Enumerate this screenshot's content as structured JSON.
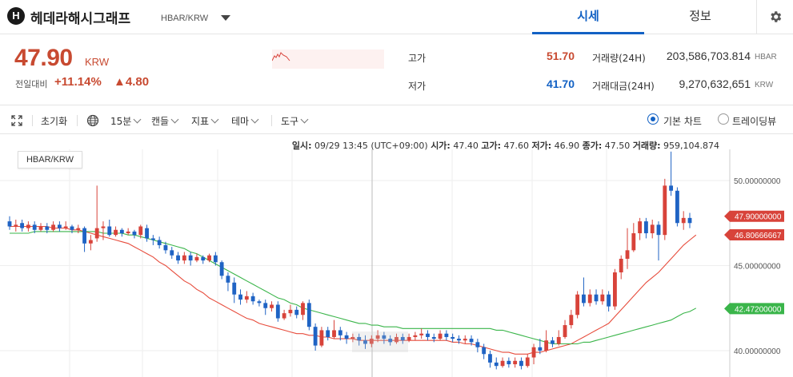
{
  "header": {
    "logo_letter": "H",
    "coin_name": "헤데라해시그래프",
    "pair": "HBAR/KRW",
    "tabs": [
      "시세",
      "정보"
    ],
    "active_tab": 0
  },
  "summary": {
    "price": "47.90",
    "currency": "KRW",
    "change_label": "전일대비",
    "change_rate": "+11.14%",
    "change_amount": "▲4.80",
    "high_label": "고가",
    "high_value": "51.70",
    "low_label": "저가",
    "low_value": "41.70",
    "volume_label": "거래량(24H)",
    "volume_value": "203,586,703.814",
    "volume_unit": "HBAR",
    "turnover_label": "거래대금(24H)",
    "turnover_value": "9,270,632,651",
    "turnover_unit": "KRW"
  },
  "toolbar": {
    "reset": "초기화",
    "interval": "15분",
    "candle": "캔들",
    "indicator": "지표",
    "theme": "테마",
    "tools": "도구",
    "basic_chart": "기본 차트",
    "trading_view": "트레이딩뷰",
    "selected_chart": "basic"
  },
  "chart_info": {
    "time_label": "일시:",
    "time_value": "09/29 13:45 (UTC+09:00)",
    "open_label": "시가:",
    "open_value": "47.40",
    "high_label": "고가:",
    "high_value": "47.60",
    "low_label": "저가:",
    "low_value": "46.90",
    "close_label": "종가:",
    "close_value": "47.50",
    "volume_label": "거래량:",
    "volume_value": "959,104.874",
    "pair_label": "HBAR/KRW"
  },
  "chart_data": {
    "type": "candlestick",
    "ylim": [
      38.5,
      51.0
    ],
    "y_ticks": [
      "50.00000000",
      "45.00000000",
      "40.00000000"
    ],
    "y_tick_values": [
      50,
      45,
      40
    ],
    "price_tags": [
      {
        "label": "47.90000000",
        "value": 47.9,
        "color": "#d8433a"
      },
      {
        "label": "46.80666667",
        "value": 46.80666667,
        "color": "#d8433a"
      },
      {
        "label": "42.47200000",
        "value": 42.472,
        "color": "#3ab54a"
      }
    ],
    "up_color": "#d8433a",
    "down_color": "#1f63c4",
    "candles": [
      [
        47.6,
        47.3,
        47.9,
        47.1
      ],
      [
        47.3,
        47.4,
        47.7,
        47.0
      ],
      [
        47.5,
        47.2,
        47.7,
        47.0
      ],
      [
        47.2,
        47.4,
        47.6,
        47.0
      ],
      [
        47.4,
        47.1,
        47.6,
        46.9
      ],
      [
        47.1,
        47.3,
        47.5,
        47.0
      ],
      [
        47.3,
        47.1,
        47.5,
        46.9
      ],
      [
        47.1,
        47.4,
        47.6,
        47.0
      ],
      [
        47.4,
        47.2,
        47.6,
        47.0
      ],
      [
        47.2,
        47.3,
        47.6,
        47.1
      ],
      [
        47.3,
        47.1,
        47.4,
        46.9
      ],
      [
        47.1,
        47.2,
        47.4,
        46.9
      ],
      [
        47.2,
        46.3,
        47.3,
        45.8
      ],
      [
        46.3,
        46.5,
        46.8,
        45.9
      ],
      [
        46.6,
        47.2,
        49.7,
        46.4
      ],
      [
        47.2,
        47.3,
        47.6,
        46.5
      ],
      [
        47.3,
        46.8,
        47.7,
        46.7
      ],
      [
        46.8,
        47.1,
        47.3,
        46.7
      ],
      [
        47.1,
        46.9,
        47.2,
        46.7
      ],
      [
        46.9,
        47.0,
        47.2,
        46.8
      ],
      [
        47.0,
        46.8,
        47.1,
        46.6
      ],
      [
        46.8,
        47.3,
        47.4,
        46.6
      ],
      [
        47.2,
        46.6,
        47.4,
        46.4
      ],
      [
        46.6,
        46.5,
        46.8,
        46.2
      ],
      [
        46.5,
        46.2,
        46.7,
        46.0
      ],
      [
        46.2,
        45.9,
        46.4,
        45.7
      ],
      [
        45.9,
        45.6,
        46.1,
        45.4
      ],
      [
        45.6,
        45.3,
        45.8,
        45.1
      ],
      [
        45.3,
        45.6,
        45.8,
        45.1
      ],
      [
        45.6,
        45.3,
        45.8,
        45.0
      ],
      [
        45.3,
        45.5,
        45.7,
        45.2
      ],
      [
        45.5,
        45.3,
        45.6,
        45.1
      ],
      [
        45.3,
        45.6,
        45.7,
        45.2
      ],
      [
        45.6,
        45.2,
        45.8,
        45.0
      ],
      [
        45.2,
        44.4,
        45.3,
        44.2
      ],
      [
        44.4,
        44.0,
        44.6,
        43.5
      ],
      [
        44.0,
        43.3,
        44.3,
        42.8
      ],
      [
        43.3,
        43.0,
        43.6,
        42.7
      ],
      [
        43.0,
        43.2,
        43.5,
        42.8
      ],
      [
        43.2,
        42.9,
        43.4,
        42.7
      ],
      [
        42.9,
        42.8,
        43.0,
        42.6
      ],
      [
        42.8,
        42.5,
        43.0,
        42.1
      ],
      [
        42.5,
        42.7,
        42.9,
        42.3
      ],
      [
        42.7,
        41.9,
        42.9,
        41.7
      ],
      [
        41.9,
        42.2,
        42.4,
        41.8
      ],
      [
        42.2,
        42.4,
        42.7,
        42.0
      ],
      [
        42.4,
        42.1,
        42.6,
        41.9
      ],
      [
        42.1,
        42.8,
        42.9,
        41.8
      ],
      [
        42.8,
        41.4,
        43.0,
        41.2
      ],
      [
        41.4,
        40.3,
        41.6,
        40.0
      ],
      [
        40.3,
        41.2,
        41.4,
        40.2
      ],
      [
        41.2,
        40.8,
        41.4,
        40.6
      ],
      [
        40.8,
        41.2,
        41.8,
        40.7
      ],
      [
        41.2,
        40.9,
        41.4,
        40.6
      ],
      [
        40.9,
        40.7,
        41.1,
        40.4
      ],
      [
        40.7,
        40.8,
        41.0,
        40.5
      ],
      [
        40.8,
        40.6,
        41.0,
        40.3
      ],
      [
        40.6,
        40.4,
        40.9,
        40.1
      ],
      [
        40.4,
        40.7,
        40.9,
        40.2
      ],
      [
        40.7,
        40.9,
        41.2,
        40.5
      ],
      [
        40.9,
        40.7,
        41.1,
        40.4
      ],
      [
        40.7,
        40.5,
        40.9,
        40.3
      ],
      [
        40.5,
        40.8,
        41.0,
        40.4
      ],
      [
        40.8,
        40.6,
        41.0,
        40.4
      ],
      [
        40.6,
        40.8,
        41.0,
        40.5
      ],
      [
        40.8,
        40.9,
        41.1,
        40.6
      ],
      [
        40.9,
        41.0,
        41.3,
        40.7
      ],
      [
        41.0,
        40.8,
        41.2,
        40.6
      ],
      [
        40.8,
        40.7,
        41.0,
        40.5
      ],
      [
        40.7,
        41.0,
        41.2,
        40.6
      ],
      [
        41.0,
        40.8,
        41.2,
        40.6
      ],
      [
        40.8,
        40.7,
        41.0,
        40.5
      ],
      [
        40.7,
        40.6,
        40.9,
        40.4
      ],
      [
        40.6,
        40.7,
        40.9,
        40.4
      ],
      [
        40.7,
        40.5,
        40.9,
        40.3
      ],
      [
        40.5,
        40.2,
        40.7,
        39.9
      ],
      [
        40.2,
        39.8,
        40.4,
        39.5
      ],
      [
        39.8,
        39.3,
        40.0,
        39.0
      ],
      [
        39.3,
        39.1,
        39.6,
        38.9
      ],
      [
        39.1,
        39.4,
        39.6,
        39.0
      ],
      [
        39.4,
        39.2,
        39.6,
        39.0
      ],
      [
        39.2,
        39.4,
        39.6,
        39.0
      ],
      [
        39.4,
        39.1,
        39.6,
        38.9
      ],
      [
        39.1,
        39.6,
        39.8,
        39.0
      ],
      [
        39.6,
        40.2,
        40.4,
        39.2
      ],
      [
        40.2,
        40.0,
        40.7,
        39.8
      ],
      [
        40.0,
        40.6,
        41.2,
        39.9
      ],
      [
        40.6,
        40.4,
        40.8,
        40.2
      ],
      [
        40.4,
        40.8,
        41.2,
        40.3
      ],
      [
        40.8,
        41.5,
        41.8,
        40.7
      ],
      [
        41.5,
        42.1,
        42.4,
        41.3
      ],
      [
        42.1,
        43.3,
        43.5,
        41.9
      ],
      [
        43.3,
        42.8,
        44.3,
        42.6
      ],
      [
        42.8,
        43.3,
        43.6,
        42.6
      ],
      [
        43.3,
        42.9,
        43.6,
        42.7
      ],
      [
        42.9,
        43.3,
        43.6,
        42.7
      ],
      [
        43.3,
        42.6,
        43.5,
        42.3
      ],
      [
        42.6,
        44.6,
        44.8,
        42.4
      ],
      [
        44.6,
        45.4,
        45.6,
        44.2
      ],
      [
        45.4,
        45.9,
        47.2,
        44.8
      ],
      [
        45.9,
        46.9,
        47.5,
        45.8
      ],
      [
        46.9,
        47.6,
        47.8,
        46.5
      ],
      [
        47.6,
        46.9,
        47.8,
        46.6
      ],
      [
        46.9,
        47.4,
        47.7,
        46.6
      ],
      [
        47.4,
        46.8,
        47.6,
        45.3
      ],
      [
        46.8,
        49.7,
        50.1,
        46.5
      ],
      [
        49.7,
        49.4,
        51.7,
        49.1
      ],
      [
        49.4,
        47.5,
        49.6,
        47.3
      ],
      [
        47.5,
        47.8,
        48.2,
        47.1
      ],
      [
        47.8,
        47.5,
        48.1,
        47.2
      ]
    ],
    "series": [
      {
        "color": "#e74c3c",
        "values": [
          47.3,
          47.3,
          47.3,
          47.3,
          47.3,
          47.3,
          47.3,
          47.2,
          47.2,
          47.2,
          47.1,
          47.1,
          47.0,
          46.9,
          46.8,
          46.7,
          46.6,
          46.5,
          46.4,
          46.3,
          46.1,
          45.9,
          45.7,
          45.5,
          45.2,
          45.0,
          44.7,
          44.4,
          44.1,
          43.9,
          43.6,
          43.4,
          43.1,
          42.9,
          42.7,
          42.5,
          42.3,
          42.1,
          41.9,
          41.8,
          41.6,
          41.5,
          41.4,
          41.3,
          41.2,
          41.1,
          41.0,
          41.0,
          40.9,
          40.9,
          40.8,
          40.8,
          40.7,
          40.7,
          40.7,
          40.7,
          40.6,
          40.6,
          40.6,
          40.6,
          40.6,
          40.6,
          40.6,
          40.6,
          40.6,
          40.6,
          40.6,
          40.6,
          40.6,
          40.6,
          40.6,
          40.5,
          40.5,
          40.4,
          40.4,
          40.3,
          40.2,
          40.1,
          40.0,
          39.9,
          39.9,
          39.8,
          39.8,
          39.8,
          39.9,
          39.9,
          40.0,
          40.1,
          40.2,
          40.3,
          40.4,
          40.6,
          40.8,
          41.0,
          41.2,
          41.4,
          41.6,
          42.0,
          42.4,
          42.8,
          43.2,
          43.6,
          44.0,
          44.3,
          44.6,
          45.0,
          45.4,
          45.8,
          46.2,
          46.5,
          46.8
        ]
      },
      {
        "color": "#3ab54a",
        "values": [
          46.9,
          46.9,
          46.9,
          46.9,
          47.0,
          47.0,
          47.0,
          47.0,
          47.0,
          47.0,
          47.0,
          47.0,
          47.0,
          47.0,
          47.0,
          46.9,
          46.9,
          46.9,
          46.9,
          46.8,
          46.8,
          46.7,
          46.6,
          46.5,
          46.4,
          46.3,
          46.2,
          46.1,
          46.0,
          45.8,
          45.7,
          45.5,
          45.3,
          45.1,
          44.9,
          44.7,
          44.5,
          44.3,
          44.1,
          43.9,
          43.7,
          43.5,
          43.3,
          43.1,
          43.0,
          42.8,
          42.7,
          42.5,
          42.4,
          42.3,
          42.2,
          42.1,
          42.0,
          41.9,
          41.8,
          41.7,
          41.6,
          41.6,
          41.5,
          41.5,
          41.4,
          41.4,
          41.4,
          41.3,
          41.3,
          41.3,
          41.3,
          41.3,
          41.3,
          41.3,
          41.3,
          41.3,
          41.3,
          41.3,
          41.3,
          41.3,
          41.3,
          41.3,
          41.2,
          41.2,
          41.1,
          41.0,
          40.9,
          40.8,
          40.7,
          40.6,
          40.5,
          40.4,
          40.4,
          40.4,
          40.4,
          40.4,
          40.5,
          40.5,
          40.6,
          40.7,
          40.8,
          40.9,
          41.0,
          41.1,
          41.2,
          41.3,
          41.4,
          41.5,
          41.6,
          41.7,
          41.8,
          42.0,
          42.2,
          42.3,
          42.5
        ]
      }
    ]
  }
}
